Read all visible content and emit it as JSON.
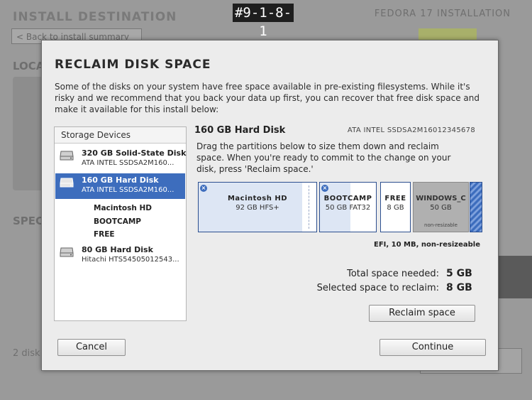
{
  "background": {
    "title": "INSTALL DESTINATION",
    "right_title": "FEDORA 17 INSTALLATION",
    "back_button": "< Back to install summary",
    "local_heading": "LOCA",
    "specialized_heading": "SPEC",
    "disks_text": "2 disk"
  },
  "watermark": "#9-1-8-1",
  "dialog": {
    "title": "RECLAIM DISK SPACE",
    "intro": "Some of the disks on your system have free space available in pre-existing filesystems. While it's risky and we recommend that you back your data up first, you can recover that free disk space and make it available for this install below:",
    "storage_header": "Storage Devices",
    "devices": [
      {
        "name": "320 GB Solid-State Disk",
        "model": "ATA INTEL SSDSA2M160...",
        "selected": false
      },
      {
        "name": "160 GB Hard Disk",
        "model": "ATA INTEL SSDSA2M160...",
        "selected": true
      },
      {
        "name": "80 GB Hard Disk",
        "model": "Hitachi HTS54505012543...",
        "selected": false
      }
    ],
    "partitions_list": [
      "Macintosh HD",
      "BOOTCAMP",
      "FREE"
    ],
    "selected_disk": {
      "title": "160 GB Hard Disk",
      "model": "ATA INTEL SSDSA2M16012345678",
      "description": "Drag the partitions below to size them down and reclaim space. When you're ready to commit to the change on your disk, press 'Reclaim space.'"
    },
    "partitions": [
      {
        "name": "Macintosh HD",
        "detail": "92 GB  HFS+",
        "fill_fraction": 0.88
      },
      {
        "name": "BOOTCAMP",
        "detail": "50 GB FAT32",
        "fill_fraction": 0.55
      },
      {
        "name": "FREE",
        "detail": "8 GB"
      },
      {
        "name": "WINDOWS_C",
        "detail": "50 GB",
        "note": "non-resizable"
      }
    ],
    "efi_label": "EFI, 10 MB, non-resizeable",
    "summary": {
      "needed_label": "Total space needed:",
      "needed_value": "5 GB",
      "reclaim_label": "Selected space to reclaim:",
      "reclaim_value": "8 GB"
    },
    "buttons": {
      "reclaim": "Reclaim space",
      "cancel": "Cancel",
      "continue": "Continue"
    },
    "colors": {
      "selection": "#3d6dbd",
      "partition_border": "#2c4f8f"
    }
  }
}
